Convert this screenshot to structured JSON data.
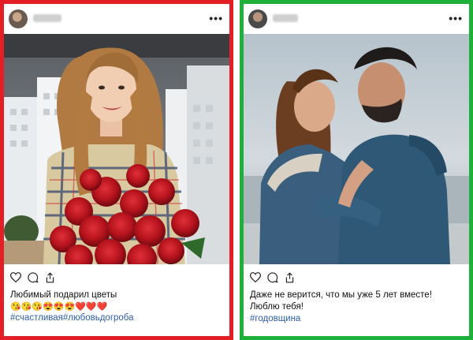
{
  "cards": [
    {
      "side": "left",
      "border_color": "#e31e24",
      "more_label": "•••",
      "caption_lines": [
        "Любимый подарил цветы"
      ],
      "emojis": "😘😘😘😍😍😍❤️❤️❤️",
      "hashtags": "#счастливая#любовьдогроба",
      "icons": [
        "heart-icon",
        "comment-icon",
        "share-icon"
      ]
    },
    {
      "side": "right",
      "border_color": "#1fb03a",
      "more_label": "•••",
      "caption_lines": [
        "Даже не верится, что мы уже 5 лет вместе!",
        "Люблю тебя!"
      ],
      "hashtags": "#годовщина",
      "icons": [
        "heart-icon",
        "comment-icon",
        "share-icon"
      ]
    }
  ]
}
